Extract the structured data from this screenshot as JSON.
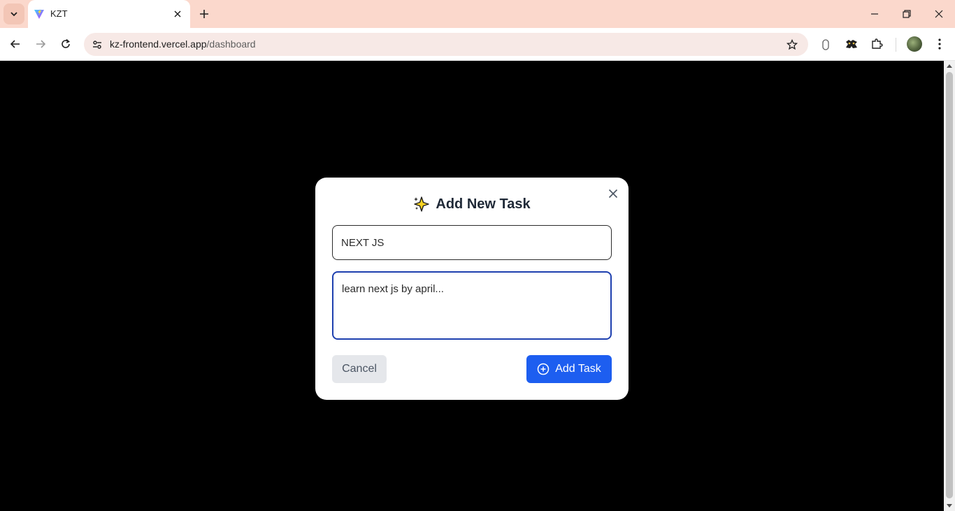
{
  "browser": {
    "tab": {
      "title": "KZT",
      "favicon": "vite-logo-icon"
    },
    "url": {
      "host": "kz-frontend.vercel.app",
      "path": "/dashboard"
    },
    "extension_badge": "0",
    "colors": {
      "tabstrip": "#fbd8cc",
      "omnibox": "#f7e9e6"
    }
  },
  "page": {
    "background": "#000000"
  },
  "modal": {
    "title": "Add New Task",
    "title_icon": "sparkle-icon",
    "title_field_value": "NEXT JS",
    "description_value": "learn next js by april...",
    "cancel_label": "Cancel",
    "add_label": "Add Task",
    "accent": "#1d5ef0"
  }
}
